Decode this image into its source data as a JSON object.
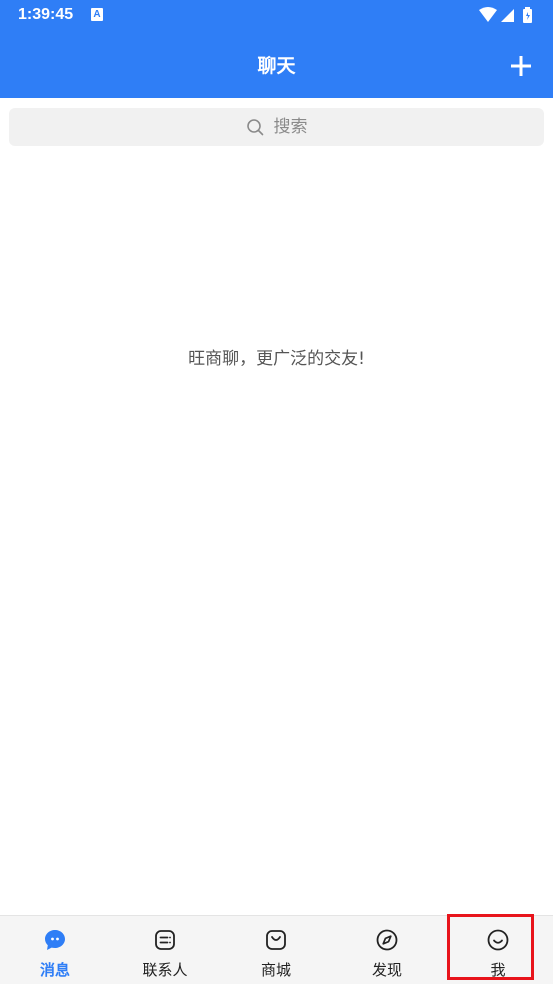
{
  "status_bar": {
    "time": "1:39:45",
    "notification_letter": "A",
    "icons": [
      "wifi-icon",
      "signal-icon",
      "battery-icon"
    ]
  },
  "header": {
    "title": "聊天",
    "add_icon": "plus-icon"
  },
  "search": {
    "placeholder": "搜索",
    "icon": "search-icon"
  },
  "empty_state": {
    "message": "旺商聊，更广泛的交友!"
  },
  "tabs": [
    {
      "label": "消息",
      "icon": "chat-bubble-icon",
      "active": true
    },
    {
      "label": "联系人",
      "icon": "contacts-icon",
      "active": false
    },
    {
      "label": "商城",
      "icon": "shopping-bag-icon",
      "active": false
    },
    {
      "label": "发现",
      "icon": "compass-icon",
      "active": false
    },
    {
      "label": "我",
      "icon": "smiley-face-icon",
      "active": false
    }
  ],
  "colors": {
    "primary": "#2f7ef6",
    "highlight": "#e8141b",
    "tab_bar_bg": "#f5f5f5",
    "search_bg": "#f1f1f1"
  }
}
